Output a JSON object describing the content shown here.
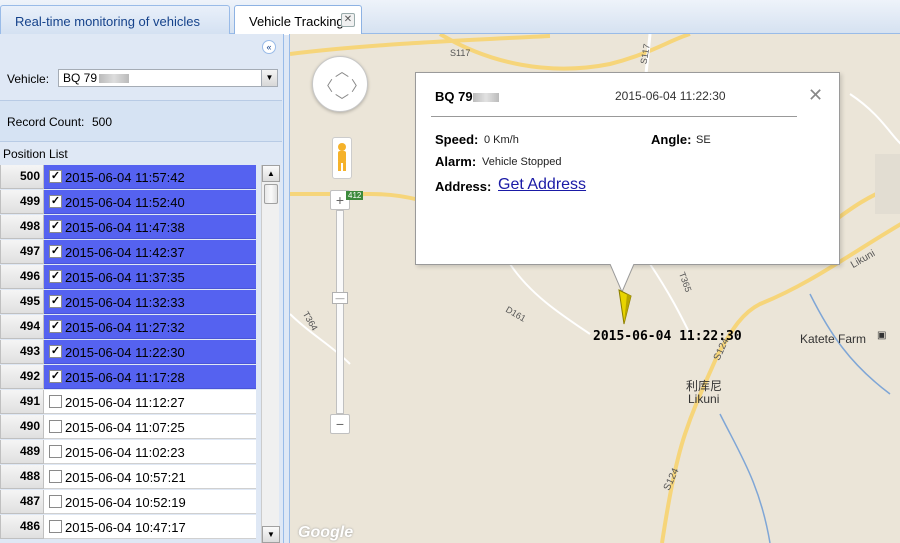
{
  "tabs": [
    {
      "label": "Real-time monitoring of vehicles"
    },
    {
      "label": "Vehicle Tracking"
    }
  ],
  "left": {
    "vehicle_label": "Vehicle:",
    "vehicle_value": "BQ 79",
    "record_label": "Record Count:",
    "record_value": "500",
    "position_list_label": "Position List"
  },
  "positions": [
    {
      "num": "500",
      "time": "2015-06-04 11:57:42",
      "checked": true
    },
    {
      "num": "499",
      "time": "2015-06-04 11:52:40",
      "checked": true
    },
    {
      "num": "498",
      "time": "2015-06-04 11:47:38",
      "checked": true
    },
    {
      "num": "497",
      "time": "2015-06-04 11:42:37",
      "checked": true
    },
    {
      "num": "496",
      "time": "2015-06-04 11:37:35",
      "checked": true
    },
    {
      "num": "495",
      "time": "2015-06-04 11:32:33",
      "checked": true
    },
    {
      "num": "494",
      "time": "2015-06-04 11:27:32",
      "checked": true
    },
    {
      "num": "493",
      "time": "2015-06-04 11:22:30",
      "checked": true
    },
    {
      "num": "492",
      "time": "2015-06-04 11:17:28",
      "checked": true
    },
    {
      "num": "491",
      "time": "2015-06-04 11:12:27",
      "checked": false
    },
    {
      "num": "490",
      "time": "2015-06-04 11:07:25",
      "checked": false
    },
    {
      "num": "489",
      "time": "2015-06-04 11:02:23",
      "checked": false
    },
    {
      "num": "488",
      "time": "2015-06-04 10:57:21",
      "checked": false
    },
    {
      "num": "487",
      "time": "2015-06-04 10:52:19",
      "checked": false
    },
    {
      "num": "486",
      "time": "2015-06-04 10:47:17",
      "checked": false
    }
  ],
  "popup": {
    "vehicle_id": "BQ 79",
    "timestamp": "2015-06-04 11:22:30",
    "speed_label": "Speed:",
    "speed_value": "0 Km/h",
    "angle_label": "Angle:",
    "angle_value": "SE",
    "alarm_label": "Alarm:",
    "alarm_value": "Vehicle Stopped",
    "address_label": "Address:",
    "address_link": "Get Address",
    "close_glyph": "✕"
  },
  "map": {
    "marker_label": "2015-06-04 11:22:30",
    "place_katete": "Katete Farm",
    "place_likuni_cn": "利库尼",
    "place_likuni": "Likuni",
    "road_s117": "S117",
    "road_s124_a": "S124",
    "road_s124_b": "S124",
    "road_t364": "T364",
    "road_t365": "T365",
    "road_d161": "D161",
    "road_likuni": "Likuni",
    "road_412": "412",
    "attribution": "Google"
  }
}
